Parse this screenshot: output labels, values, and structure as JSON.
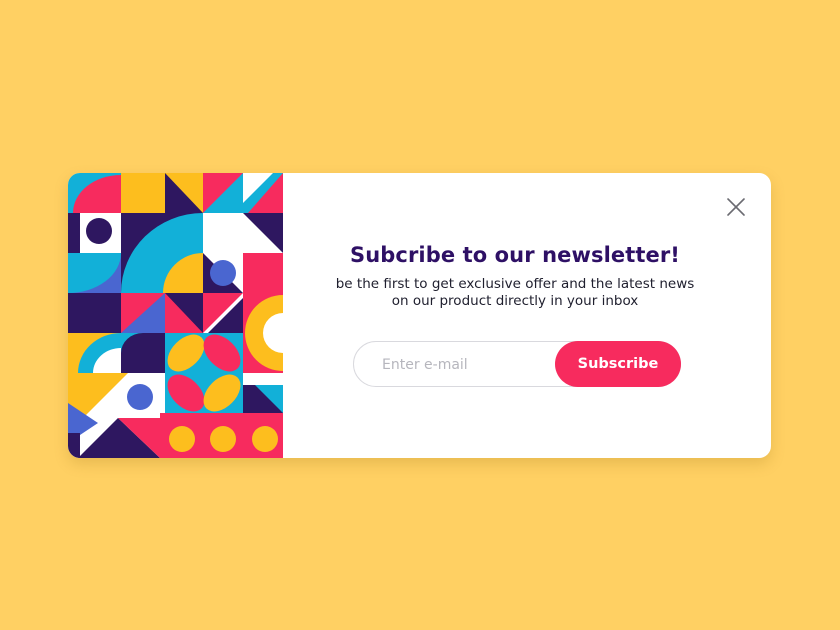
{
  "popup": {
    "title": "Subcribe to our newsletter!",
    "subtitle": "be the first to get exclusive offer and the latest news on our product directly in your inbox",
    "email_placeholder": "Enter e-mail",
    "subscribe_label": "Subscribe",
    "close_icon": "close-icon",
    "artwork": "geometric-pattern-illustration"
  },
  "colors": {
    "background": "#FFD063",
    "card": "#FFFFFF",
    "title": "#2E1065",
    "accent": "#F72B5E",
    "pattern_navy": "#2E1760",
    "pattern_cyan": "#12B0D8",
    "pattern_yellow": "#FDBE1E",
    "pattern_pink": "#F72B5E",
    "pattern_blue": "#4A66D0"
  }
}
